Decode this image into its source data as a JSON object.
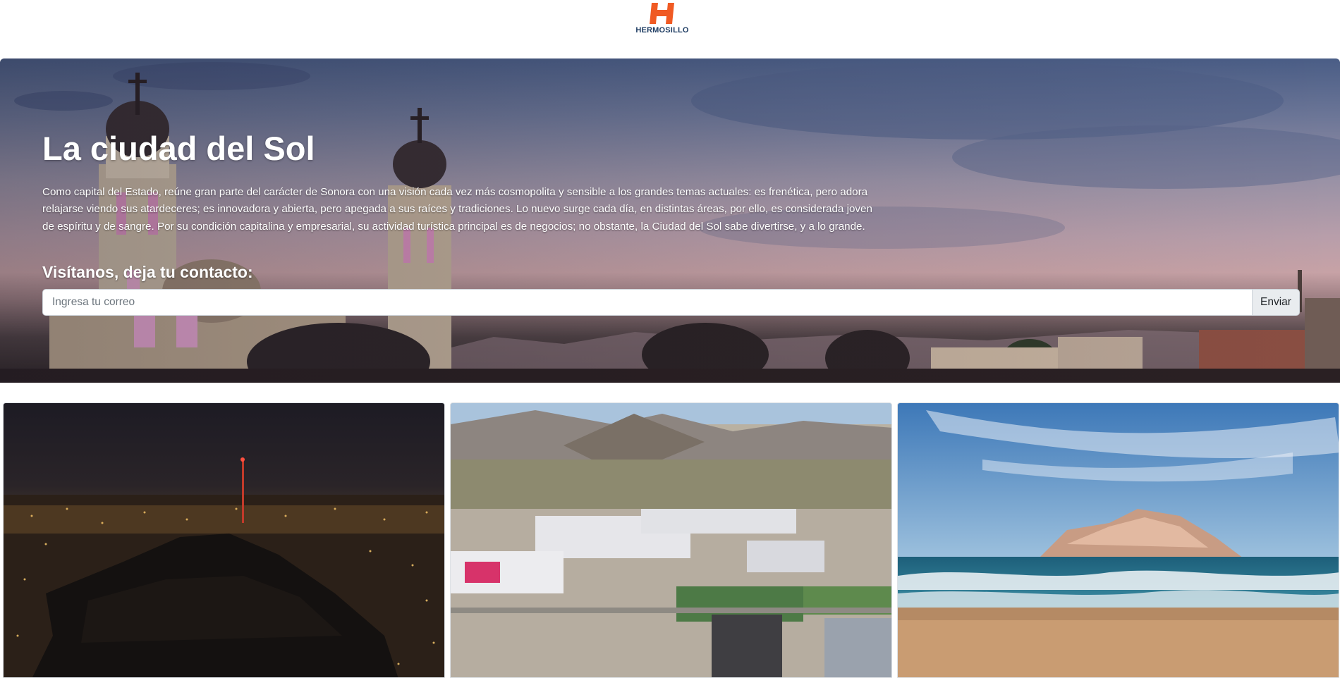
{
  "header": {
    "logo_text": "HERMOSILLO",
    "logo_icon": "hermosillo-h-logo-icon",
    "brand_color": "#f05a23"
  },
  "hero": {
    "title": "La ciudad del Sol",
    "description": "Como capital del Estado, reúne gran parte del carácter de Sonora con una visión cada vez más cosmopolita y sensible a los grandes temas actuales: es frenética, pero adora relajarse viendo sus atardeceres; es innovadora y abierta, pero apegada a sus raíces y tradiciones. Lo nuevo surge cada día, en distintas áreas, por ello, es considerada joven de espíritu y de sangre. Por su condición capitalina y empresarial, su actividad turística principal es de negocios; no obstante, la Ciudad del Sol sabe divertirse, y a lo grande.",
    "contact_heading": "Visítanos, deja tu contacto:",
    "email_placeholder": "Ingresa tu correo",
    "email_value": "",
    "submit_label": "Enviar",
    "background_image": "cathedral-sunset-skyline"
  },
  "gallery": [
    {
      "image": "city-lights-night-hill"
    },
    {
      "image": "aerial-shopping-center-mountains"
    },
    {
      "image": "beach-waves-rock-island"
    }
  ]
}
